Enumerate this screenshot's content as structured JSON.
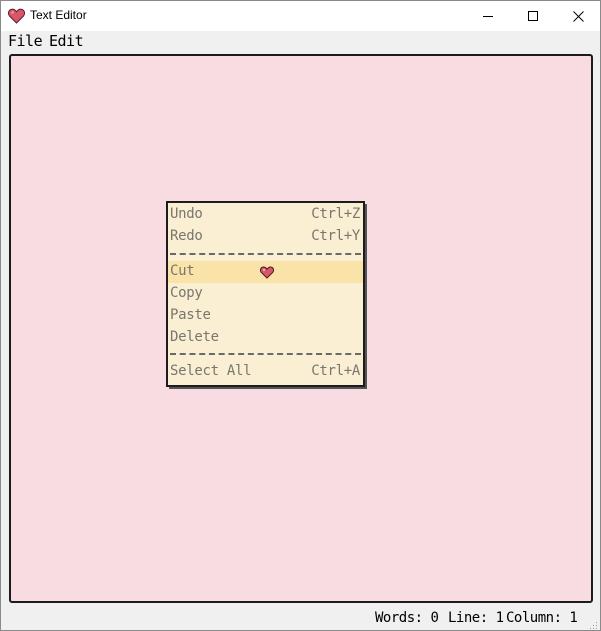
{
  "window": {
    "title": "Text Editor",
    "icon": "heart-icon",
    "controls": [
      "minimize-icon",
      "maximize-icon",
      "close-icon"
    ]
  },
  "menubar": {
    "file_label": "File",
    "edit_label": "Edit"
  },
  "editor": {
    "content": "",
    "background": "#f9dce1"
  },
  "context_menu": {
    "background": "#faefd3",
    "highlight": "#f9e3a9",
    "items": [
      {
        "label": "Undo",
        "shortcut": "Ctrl+Z"
      },
      {
        "label": "Redo",
        "shortcut": "Ctrl+Y"
      },
      {
        "label": "Cut",
        "shortcut": ""
      },
      {
        "label": "Copy",
        "shortcut": ""
      },
      {
        "label": "Paste",
        "shortcut": ""
      },
      {
        "label": "Delete",
        "shortcut": ""
      },
      {
        "label": "Select All",
        "shortcut": "Ctrl+A"
      }
    ],
    "hovered": "Cut",
    "cursor_icon": "heart-cursor-icon"
  },
  "statusbar": {
    "words": "Words: 0",
    "line": "Line: 1",
    "column": "Column: 1"
  }
}
